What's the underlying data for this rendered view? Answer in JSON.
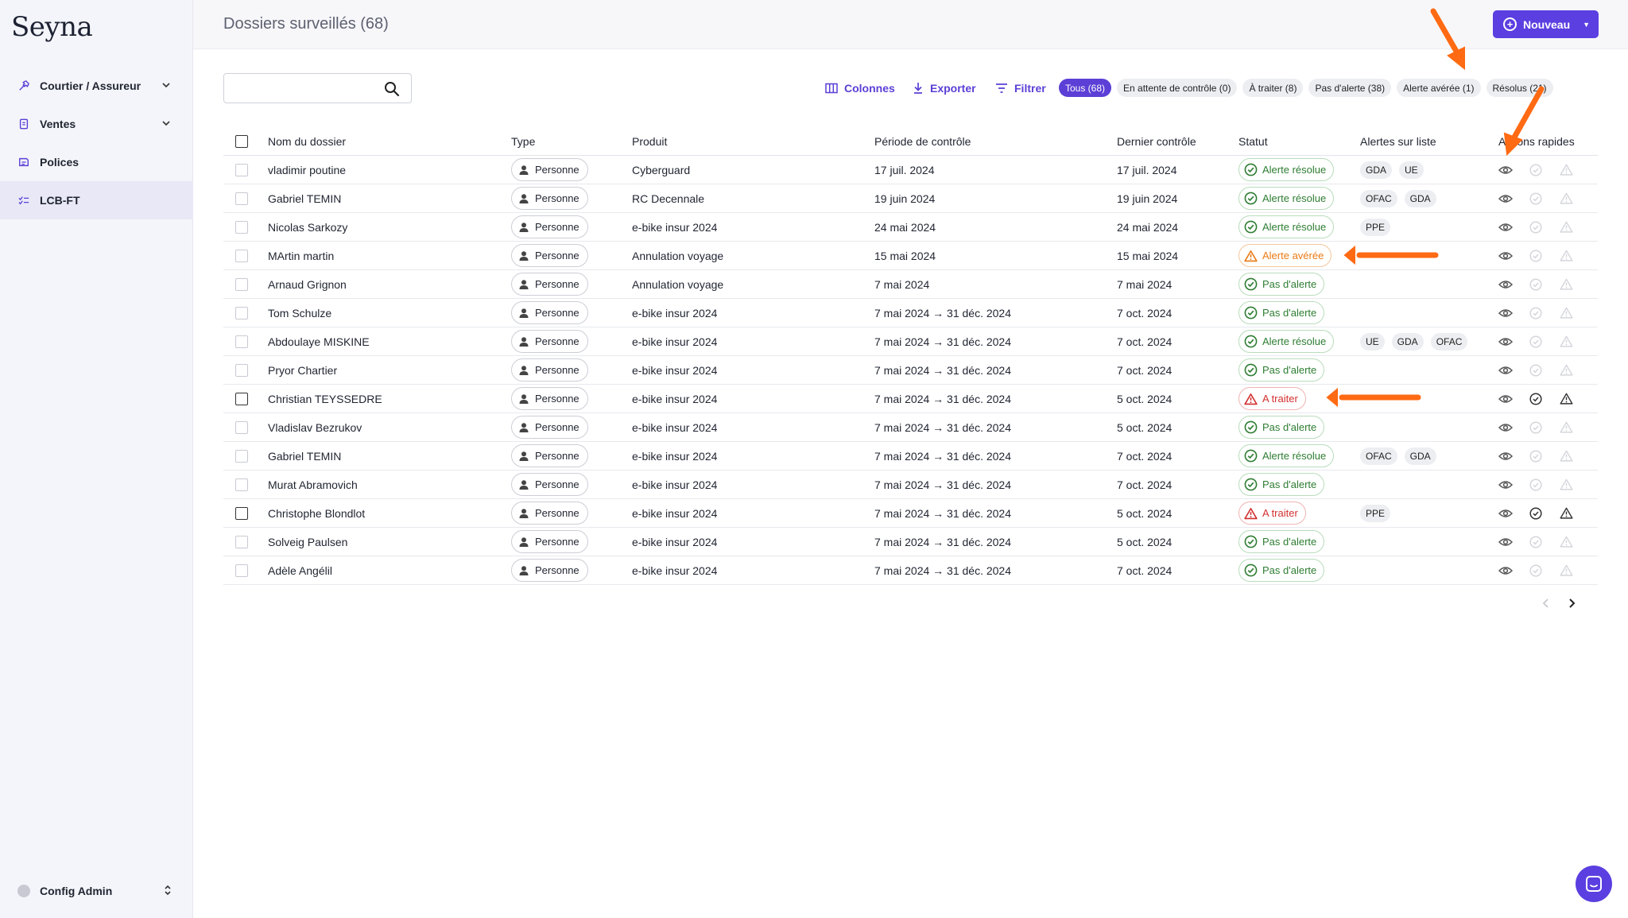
{
  "app": {
    "logo": "Seyna"
  },
  "sidebar": {
    "items": [
      {
        "label": "Courtier / Assureur",
        "icon": "hammer-icon",
        "expandable": true
      },
      {
        "label": "Ventes",
        "icon": "document-icon",
        "expandable": true
      },
      {
        "label": "Polices",
        "icon": "policy-icon",
        "expandable": false
      },
      {
        "label": "LCB-FT",
        "icon": "checklist-icon",
        "expandable": false,
        "active": true
      }
    ],
    "footer": {
      "label": "Config Admin"
    }
  },
  "header": {
    "title": "Dossiers surveillés (68)",
    "new_button": "Nouveau"
  },
  "toolbar": {
    "search_placeholder": "",
    "columns": "Colonnes",
    "export": "Exporter",
    "filter": "Filtrer",
    "chips": [
      {
        "label": "Tous (68)",
        "active": true
      },
      {
        "label": "En attente de contrôle (0)"
      },
      {
        "label": "À traiter (8)"
      },
      {
        "label": "Pas d'alerte (38)"
      },
      {
        "label": "Alerte avérée (1)"
      },
      {
        "label": "Résolus (21)"
      }
    ]
  },
  "table": {
    "headers": [
      "Nom du dossier",
      "Type",
      "Produit",
      "Période de contrôle",
      "Dernier contrôle",
      "Statut",
      "Alertes sur liste",
      "Actions rapides"
    ],
    "rows": [
      {
        "name": "vladimir poutine",
        "type": "Personne",
        "product": "Cyberguard",
        "period": "17 juil. 2024",
        "last": "17 juil. 2024",
        "status": "Alerte résolue",
        "tone": "green",
        "alerts": [
          "GDA",
          "UE"
        ]
      },
      {
        "name": "Gabriel TEMIN",
        "type": "Personne",
        "product": "RC Decennale",
        "period": "19 juin 2024",
        "last": "19 juin 2024",
        "status": "Alerte résolue",
        "tone": "green",
        "alerts": [
          "OFAC",
          "GDA"
        ]
      },
      {
        "name": "Nicolas Sarkozy",
        "type": "Personne",
        "product": "e-bike insur 2024",
        "period": "24 mai 2024",
        "last": "24 mai 2024",
        "status": "Alerte résolue",
        "tone": "green",
        "alerts": [
          "PPE"
        ]
      },
      {
        "name": "MArtin martin",
        "type": "Personne",
        "product": "Annulation voyage",
        "period": "15 mai 2024",
        "last": "15 mai 2024",
        "status": "Alerte avérée",
        "tone": "orange",
        "alerts": []
      },
      {
        "name": "Arnaud Grignon",
        "type": "Personne",
        "product": "Annulation voyage",
        "period": "7 mai 2024",
        "last": "7 mai 2024",
        "status": "Pas d'alerte",
        "tone": "green",
        "alerts": []
      },
      {
        "name": "Tom Schulze",
        "type": "Personne",
        "product": "e-bike insur 2024",
        "period": "7 mai 2024 → 31 déc. 2024",
        "last": "7 oct. 2024",
        "status": "Pas d'alerte",
        "tone": "green",
        "alerts": []
      },
      {
        "name": "Abdoulaye MISKINE",
        "type": "Personne",
        "product": "e-bike insur 2024",
        "period": "7 mai 2024 → 31 déc. 2024",
        "last": "7 oct. 2024",
        "status": "Alerte résolue",
        "tone": "green",
        "alerts": [
          "UE",
          "GDA",
          "OFAC"
        ]
      },
      {
        "name": "Pryor Chartier",
        "type": "Personne",
        "product": "e-bike insur 2024",
        "period": "7 mai 2024 → 31 déc. 2024",
        "last": "7 oct. 2024",
        "status": "Pas d'alerte",
        "tone": "green",
        "alerts": []
      },
      {
        "name": "Christian TEYSSEDRE",
        "type": "Personne",
        "product": "e-bike insur 2024",
        "period": "7 mai 2024 → 31 déc. 2024",
        "last": "5 oct. 2024",
        "status": "A traiter",
        "tone": "red",
        "alerts": []
      },
      {
        "name": "Vladislav Bezrukov",
        "type": "Personne",
        "product": "e-bike insur 2024",
        "period": "7 mai 2024 → 31 déc. 2024",
        "last": "5 oct. 2024",
        "status": "Pas d'alerte",
        "tone": "green",
        "alerts": []
      },
      {
        "name": "Gabriel TEMIN",
        "type": "Personne",
        "product": "e-bike insur 2024",
        "period": "7 mai 2024 → 31 déc. 2024",
        "last": "7 oct. 2024",
        "status": "Alerte résolue",
        "tone": "green",
        "alerts": [
          "OFAC",
          "GDA"
        ]
      },
      {
        "name": "Murat Abramovich",
        "type": "Personne",
        "product": "e-bike insur 2024",
        "period": "7 mai 2024 → 31 déc. 2024",
        "last": "7 oct. 2024",
        "status": "Pas d'alerte",
        "tone": "green",
        "alerts": []
      },
      {
        "name": "Christophe Blondlot",
        "type": "Personne",
        "product": "e-bike insur 2024",
        "period": "7 mai 2024 → 31 déc. 2024",
        "last": "5 oct. 2024",
        "status": "A traiter",
        "tone": "red",
        "alerts": [
          "PPE"
        ]
      },
      {
        "name": "Solveig Paulsen",
        "type": "Personne",
        "product": "e-bike insur 2024",
        "period": "7 mai 2024 → 31 déc. 2024",
        "last": "5 oct. 2024",
        "status": "Pas d'alerte",
        "tone": "green",
        "alerts": []
      },
      {
        "name": "Adèle Angélil",
        "type": "Personne",
        "product": "e-bike insur 2024",
        "period": "7 mai 2024 → 31 déc. 2024",
        "last": "7 oct. 2024",
        "status": "Pas d'alerte",
        "tone": "green",
        "alerts": []
      }
    ]
  },
  "colors": {
    "accent": "#5b3fe0",
    "green": "#2e7d32",
    "orange": "#ea7a14",
    "red": "#d32f2f",
    "annotation": "#ff6a13"
  }
}
